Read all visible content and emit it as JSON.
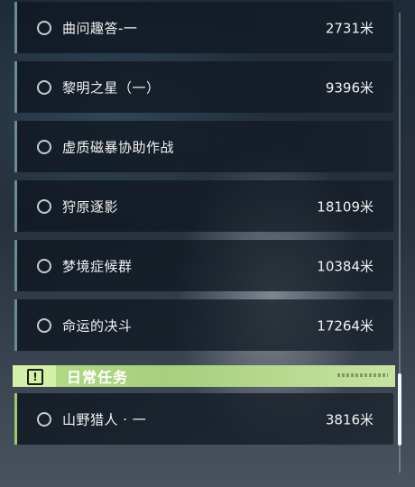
{
  "quests": [
    {
      "name": "曲问趣答-一",
      "distance": "2731米"
    },
    {
      "name": "黎明之星（一）",
      "distance": "9396米"
    },
    {
      "name": "虚质磁暴协助作战",
      "distance": ""
    },
    {
      "name": "狩原逐影",
      "distance": "18109米"
    },
    {
      "name": "梦境症候群",
      "distance": "10384米"
    },
    {
      "name": "命运的决斗",
      "distance": "17264米"
    }
  ],
  "daily_section": {
    "title": "日常任务",
    "badge_glyph": "!",
    "badge_icon": "alert-icon",
    "accent_color": "#b7dc8a",
    "items": [
      {
        "name": "山野猎人 · 一",
        "distance": "3816米"
      }
    ]
  },
  "scrollbar": {
    "position_fraction": 0.93
  },
  "colors": {
    "quest_border": "#6b8a98",
    "daily_border": "#9bc96f",
    "text": "#f2f2f2"
  }
}
